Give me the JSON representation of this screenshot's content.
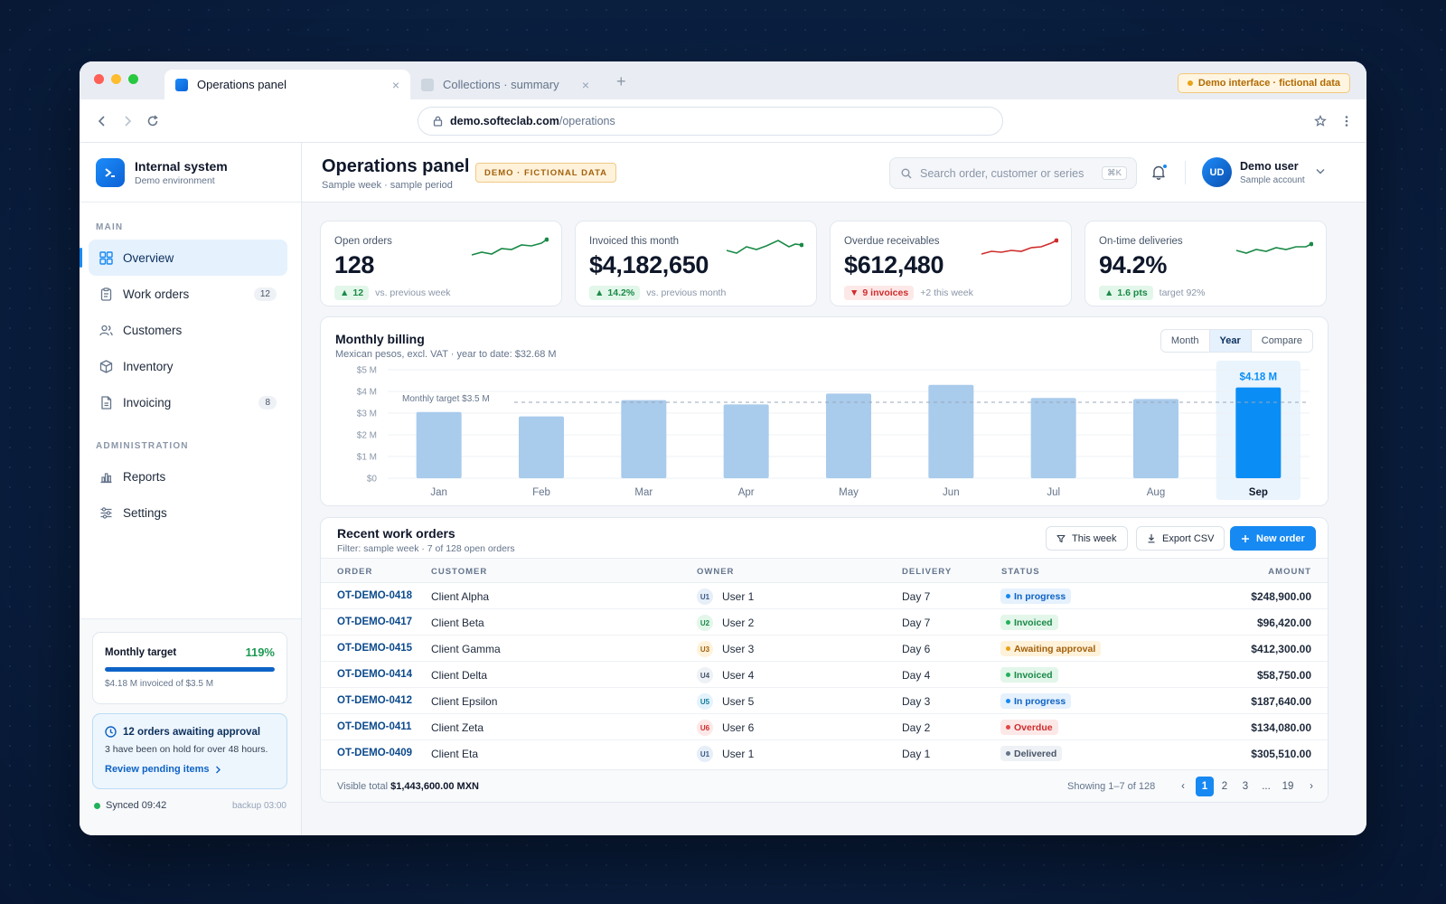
{
  "browser": {
    "tabs": [
      {
        "label": "Operations panel"
      },
      {
        "label": "Collections · summary"
      }
    ],
    "demo_pill": "Demo interface · fictional data",
    "url_host": "demo.softeclab.com",
    "url_path": "/operations"
  },
  "sidebar": {
    "brand_title": "Internal system",
    "brand_sub": "Demo environment",
    "section_main": "MAIN",
    "section_admin": "ADMINISTRATION",
    "items": [
      {
        "label": "Overview",
        "icon": "grid-icon",
        "count": ""
      },
      {
        "label": "Work orders",
        "icon": "clipboard-icon",
        "count": "12"
      },
      {
        "label": "Customers",
        "icon": "users-icon",
        "count": ""
      },
      {
        "label": "Inventory",
        "icon": "box-icon",
        "count": ""
      },
      {
        "label": "Invoicing",
        "icon": "document-icon",
        "count": "8"
      },
      {
        "label": "Reports",
        "icon": "chart-icon",
        "count": ""
      },
      {
        "label": "Settings",
        "icon": "sliders-icon",
        "count": ""
      }
    ],
    "target": {
      "label": "Monthly target",
      "pct": "119%",
      "progress": 1.0,
      "foot": "$4.18 M invoiced of $3.5 M"
    },
    "approval": {
      "title": "12 orders awaiting approval",
      "desc": "3 have been on hold for over 48 hours.",
      "link": "Review pending items"
    },
    "synced": "Synced 09:42",
    "backup": "backup 03:00"
  },
  "header": {
    "title": "Operations panel",
    "subtitle": "Sample week · sample period",
    "badge": "DEMO · FICTIONAL DATA",
    "search_placeholder": "Search order, customer or series",
    "search_kbd": "⌘K",
    "user_initials": "UD",
    "user_name": "Demo user",
    "user_sub": "Sample account"
  },
  "kpis": [
    {
      "label": "Open orders",
      "value": "128",
      "delta": "12",
      "dir": "up",
      "note": "vs. previous week",
      "color": "#1a8a47"
    },
    {
      "label": "Invoiced this month",
      "value": "$4,182,650",
      "delta": "14.2%",
      "dir": "up",
      "note": "vs. previous month",
      "color": "#1a8a47"
    },
    {
      "label": "Overdue receivables",
      "value": "$612,480",
      "delta": "9 invoices",
      "dir": "down",
      "note": "+2 this week",
      "color": "#cf2c2c"
    },
    {
      "label": "On-time deliveries",
      "value": "94.2%",
      "delta": "1.6 pts",
      "dir": "up",
      "note": "target 92%",
      "color": "#1a8a47"
    }
  ],
  "billing": {
    "title": "Monthly billing",
    "subtitle": "Mexican pesos, excl. VAT · year to date: $32.68 M",
    "toggle": [
      "Month",
      "Year",
      "Compare"
    ],
    "toggle_active": 1
  },
  "chart_data": {
    "type": "bar",
    "categories": [
      "Jan",
      "Feb",
      "Mar",
      "Apr",
      "May",
      "Jun",
      "Jul",
      "Aug",
      "Sep"
    ],
    "values": [
      3.05,
      2.85,
      3.6,
      3.4,
      3.9,
      4.3,
      3.7,
      3.65,
      4.18
    ],
    "ylim": [
      0,
      5
    ],
    "yticks": [
      "$0",
      "$1 M",
      "$2 M",
      "$3 M",
      "$4 M",
      "$5 M"
    ],
    "target": 3.5,
    "target_label": "Monthly target $3.5 M",
    "highlight_index": 8,
    "highlight_label": "$4.18 M",
    "bar_color": "#a9cbec",
    "highlight_color": "#0a8ef5"
  },
  "orders": {
    "title": "Recent work orders",
    "subtitle": "Filter: sample week · 7 of 128 open orders",
    "btn_week": "This week",
    "btn_export": "Export CSV",
    "btn_new": "New order",
    "columns": [
      "ORDER",
      "CUSTOMER",
      "OWNER",
      "DELIVERY",
      "STATUS",
      "AMOUNT"
    ],
    "rows": [
      {
        "id": "OT-DEMO-0418",
        "customer": "Client Alpha",
        "u": "U1",
        "owner": "User 1",
        "delivery": "Day 7",
        "status": "In progress",
        "amount": "$248,900.00"
      },
      {
        "id": "OT-DEMO-0417",
        "customer": "Client Beta",
        "u": "U2",
        "owner": "User 2",
        "delivery": "Day 7",
        "status": "Invoiced",
        "amount": "$96,420.00"
      },
      {
        "id": "OT-DEMO-0415",
        "customer": "Client Gamma",
        "u": "U3",
        "owner": "User 3",
        "delivery": "Day 6",
        "status": "Awaiting approval",
        "amount": "$412,300.00"
      },
      {
        "id": "OT-DEMO-0414",
        "customer": "Client Delta",
        "u": "U4",
        "owner": "User 4",
        "delivery": "Day 4",
        "status": "Invoiced",
        "amount": "$58,750.00"
      },
      {
        "id": "OT-DEMO-0412",
        "customer": "Client Epsilon",
        "u": "U5",
        "owner": "User 5",
        "delivery": "Day 3",
        "status": "In progress",
        "amount": "$187,640.00"
      },
      {
        "id": "OT-DEMO-0411",
        "customer": "Client Zeta",
        "u": "U6",
        "owner": "User 6",
        "delivery": "Day 2",
        "status": "Overdue",
        "amount": "$134,080.00"
      },
      {
        "id": "OT-DEMO-0409",
        "customer": "Client Eta",
        "u": "U1",
        "owner": "User 1",
        "delivery": "Day 1",
        "status": "Delivered",
        "amount": "$305,510.00"
      }
    ],
    "total_label": "Visible total",
    "total_value": "$1,443,600.00 MXN",
    "showing": "Showing 1–7 of 128",
    "pages": [
      "‹",
      "1",
      "2",
      "3",
      "...",
      "19",
      "›"
    ],
    "page_active": 1
  }
}
